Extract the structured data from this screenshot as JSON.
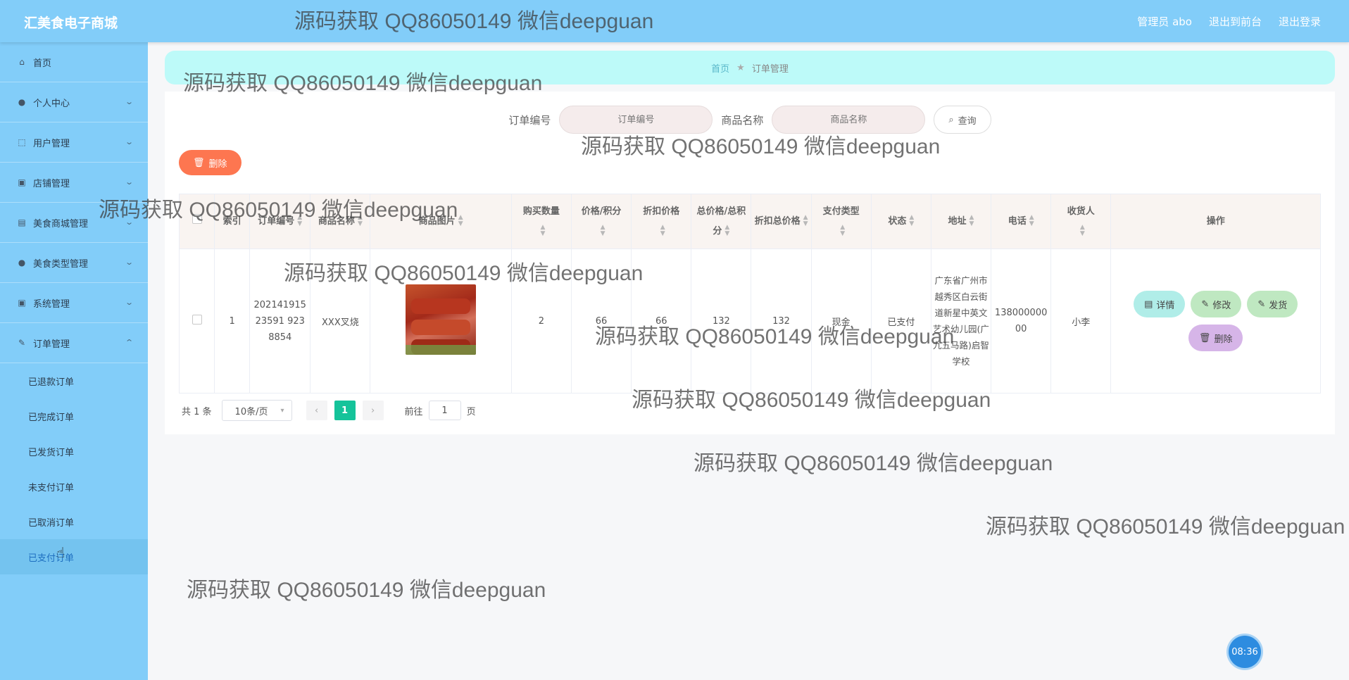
{
  "header": {
    "brand": "汇美食电子商城",
    "admin_label": "管理员 abo",
    "to_front": "退出到前台",
    "logout": "退出登录"
  },
  "sidebar": {
    "items": [
      {
        "label": "首页",
        "icon": "home-icon"
      },
      {
        "label": "个人中心",
        "icon": "user-icon"
      },
      {
        "label": "用户管理",
        "icon": "users-icon"
      },
      {
        "label": "店铺管理",
        "icon": "shop-icon"
      },
      {
        "label": "美食商城管理",
        "icon": "store-icon"
      },
      {
        "label": "美食类型管理",
        "icon": "category-icon"
      },
      {
        "label": "系统管理",
        "icon": "system-icon"
      },
      {
        "label": "订单管理",
        "icon": "order-icon"
      }
    ],
    "sub_items": [
      "已退款订单",
      "已完成订单",
      "已发货订单",
      "未支付订单",
      "已取消订单",
      "已支付订单"
    ],
    "active_sub": "已支付订单"
  },
  "breadcrumb": {
    "home": "首页",
    "current": "订单管理"
  },
  "search": {
    "order_no_label": "订单编号",
    "order_no_placeholder": "订单编号",
    "product_label": "商品名称",
    "product_placeholder": "商品名称",
    "query_label": "查询"
  },
  "toolbar": {
    "delete_label": "删除"
  },
  "table": {
    "headers": {
      "index": "索引",
      "order_no": "订单编号",
      "product_name": "商品名称",
      "product_image": "商品图片",
      "qty": "购买数量",
      "price": "价格/积分",
      "discount_price": "折扣价格",
      "total": "总价格/总积分",
      "discount_total": "折扣总价格",
      "pay_type": "支付类型",
      "status": "状态",
      "address": "地址",
      "phone": "电话",
      "receiver": "收货人",
      "actions": "操作"
    },
    "rows": [
      {
        "index": "1",
        "order_no": "20214191523591 9238854",
        "product_name": "XXX叉烧",
        "qty": "2",
        "price": "66",
        "discount_price": "66",
        "total": "132",
        "discount_total": "132",
        "pay_type": "现金",
        "status": "已支付",
        "address": "广东省广州市越秀区白云街道新星中英文艺术幼儿园(广九五马路)启智学校",
        "phone": "13800000000",
        "receiver": "小李"
      }
    ],
    "actions": {
      "detail": "详情",
      "edit": "修改",
      "ship": "发货",
      "delete": "删除"
    }
  },
  "pagination": {
    "total": "共 1 条",
    "page_size": "10条/页",
    "current_page": "1",
    "goto_prefix": "前往",
    "goto_value": "1",
    "goto_suffix": "页"
  },
  "watermark": "源码获取 QQ86050149 微信deepguan",
  "clock": "08:36",
  "colors": {
    "header": "#82cdf9",
    "primary": "#15c39a",
    "delete": "#fd7650"
  }
}
